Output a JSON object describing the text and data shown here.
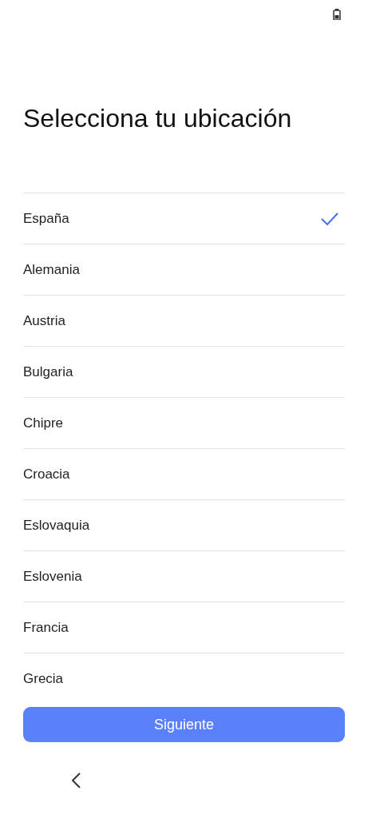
{
  "title": "Selecciona tu ubicación",
  "countries": [
    {
      "label": "España",
      "selected": true
    },
    {
      "label": "Alemania",
      "selected": false
    },
    {
      "label": "Austria",
      "selected": false
    },
    {
      "label": "Bulgaria",
      "selected": false
    },
    {
      "label": "Chipre",
      "selected": false
    },
    {
      "label": "Croacia",
      "selected": false
    },
    {
      "label": "Eslovaquia",
      "selected": false
    },
    {
      "label": "Eslovenia",
      "selected": false
    },
    {
      "label": "Francia",
      "selected": false
    },
    {
      "label": "Grecia",
      "selected": false
    }
  ],
  "next_button": "Siguiente"
}
